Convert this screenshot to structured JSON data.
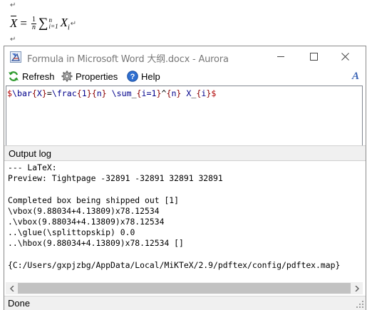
{
  "document": {
    "paragraph_mark": "↵",
    "formula": {
      "xbar": "X",
      "equals": "=",
      "frac_num": "1",
      "frac_den": "n",
      "sigma": "∑",
      "upper": "n",
      "lower": "i=1",
      "term": "X",
      "term_sub": "i"
    }
  },
  "window": {
    "title": "Formula in Microsoft Word 大纲.docx - Aurora",
    "controls": {
      "minimize": "minimize",
      "maximize": "maximize",
      "close": "close"
    }
  },
  "toolbar": {
    "refresh_label": "Refresh",
    "properties_label": "Properties",
    "help_label": "Help",
    "font_icon": "A"
  },
  "editor": {
    "tokens": [
      {
        "t": "$",
        "k": "dollar"
      },
      {
        "t": "\\bar",
        "k": "cmd"
      },
      {
        "t": "{",
        "k": "brace"
      },
      {
        "t": "X",
        "k": "cmd"
      },
      {
        "t": "}",
        "k": "brace"
      },
      {
        "t": "=",
        "k": "plain"
      },
      {
        "t": "\\frac",
        "k": "cmd"
      },
      {
        "t": "{",
        "k": "brace"
      },
      {
        "t": "1",
        "k": "cmd"
      },
      {
        "t": "}",
        "k": "brace"
      },
      {
        "t": "{",
        "k": "brace"
      },
      {
        "t": "n",
        "k": "cmd"
      },
      {
        "t": "}",
        "k": "brace"
      },
      {
        "t": " \\sum",
        "k": "cmd"
      },
      {
        "t": "_",
        "k": "plain"
      },
      {
        "t": "{",
        "k": "brace"
      },
      {
        "t": "i=1",
        "k": "cmd"
      },
      {
        "t": "}",
        "k": "brace"
      },
      {
        "t": "^",
        "k": "plain"
      },
      {
        "t": "{",
        "k": "brace"
      },
      {
        "t": "n",
        "k": "cmd"
      },
      {
        "t": "}",
        "k": "brace"
      },
      {
        "t": " X",
        "k": "cmd"
      },
      {
        "t": "_",
        "k": "plain"
      },
      {
        "t": "{",
        "k": "brace"
      },
      {
        "t": "i",
        "k": "cmd"
      },
      {
        "t": "}",
        "k": "brace"
      },
      {
        "t": "$",
        "k": "dollar"
      }
    ]
  },
  "output_log": {
    "header": "Output log",
    "lines": [
      "--- LaTeX:",
      "Preview: Tightpage -32891 -32891 32891 32891",
      "",
      "Completed box being shipped out [1]",
      "\\vbox(9.88034+4.13809)x78.12534",
      ".\\vbox(9.88034+4.13809)x78.12534",
      "..\\glue(\\splittopskip) 0.0",
      "..\\hbox(9.88034+4.13809)x78.12534 []",
      "",
      "{C:/Users/gxpjzbg/AppData/Local/MiKTeX/2.9/pdftex/config/pdftex.map}"
    ]
  },
  "statusbar": {
    "text": "Done"
  },
  "colors": {
    "dollar": "#b00000",
    "cmd": "#00008b",
    "brace": "#8b0000"
  }
}
